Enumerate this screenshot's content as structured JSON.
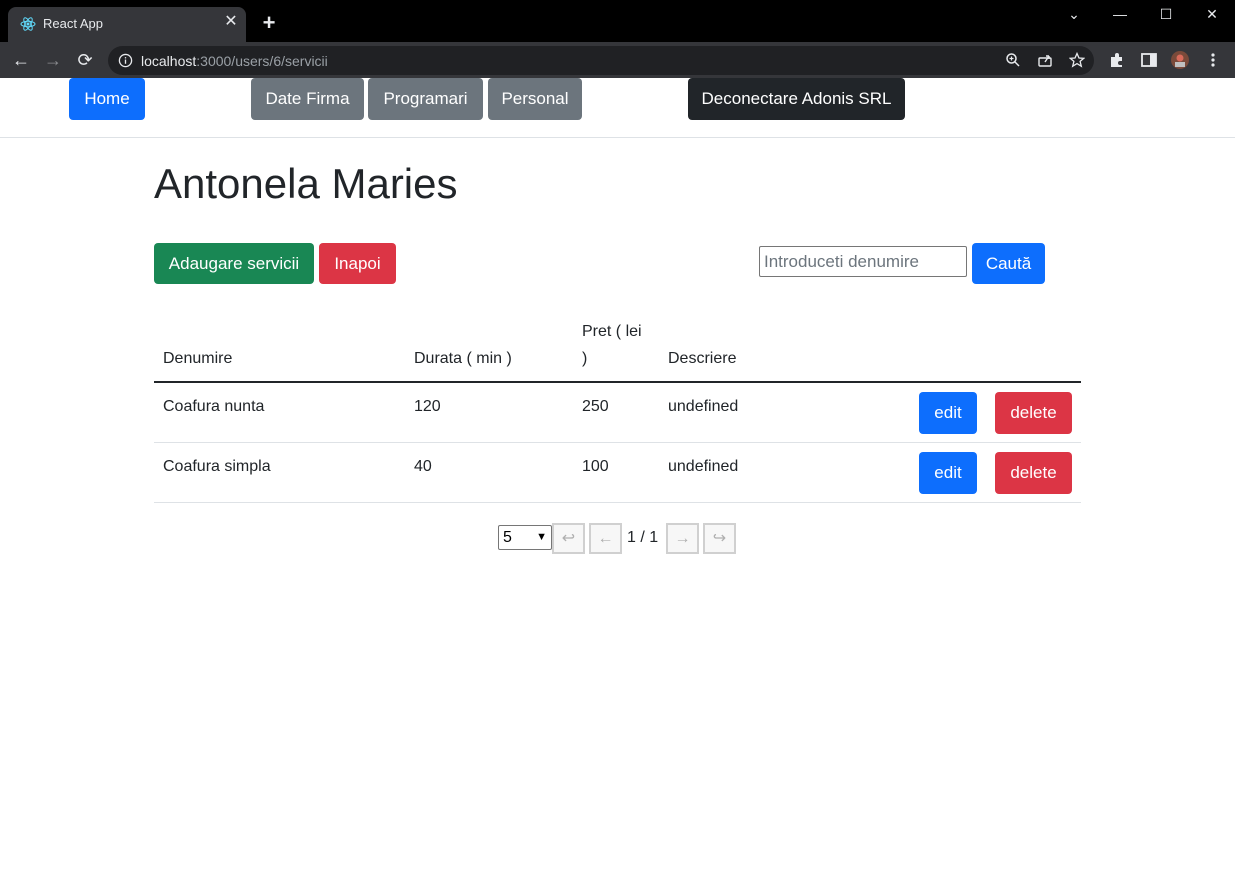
{
  "browser": {
    "tab_title": "React App",
    "tab_close": "✕",
    "new_tab": "+",
    "url_host": "localhost",
    "url_path": ":3000/users/6/servicii",
    "window_controls": {
      "chevron": "⌄",
      "minimize": "—",
      "maximize": "☐",
      "close": "✕"
    },
    "nav": {
      "back": "←",
      "forward": "→",
      "reload": "⟳"
    }
  },
  "navbar": {
    "home": "Home",
    "date_firma": "Date Firma",
    "programari": "Programari",
    "personal": "Personal",
    "logout": "Deconectare Adonis SRL"
  },
  "main": {
    "title": "Antonela Maries",
    "add_button": "Adaugare servicii",
    "back_button": "Inapoi",
    "search_placeholder": "Introduceti denumire",
    "search_button": "Caută"
  },
  "table": {
    "headers": {
      "name": "Denumire",
      "duration": "Durata ( min )",
      "price_line1": "Pret ( lei",
      "price_line2": ")",
      "description": "Descriere"
    },
    "rows": [
      {
        "name": "Coafura nunta",
        "duration": "120",
        "price": "250",
        "description": "undefined",
        "edit": "edit",
        "delete": "delete"
      },
      {
        "name": "Coafura simpla",
        "duration": "40",
        "price": "100",
        "description": "undefined",
        "edit": "edit",
        "delete": "delete"
      }
    ]
  },
  "pagination": {
    "page_size": "5",
    "first": "↩",
    "prev": "←",
    "page_label": "1 / 1",
    "next": "→",
    "last": "↪"
  },
  "colors": {
    "primary": "#0d6efd",
    "secondary": "#6c757d",
    "dark": "#212529",
    "success": "#198754",
    "danger": "#dc3545"
  }
}
